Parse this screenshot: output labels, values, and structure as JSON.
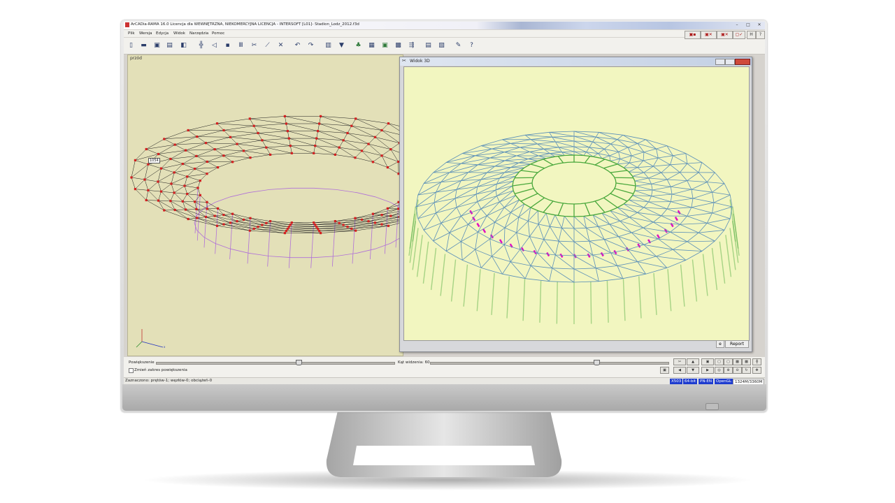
{
  "app": {
    "title": "ArCADia-RAMA 16.0 Licencja dla WEWNĘTRZNA, NIEKOMERCYJNA LICENCJA - INTERSOFT [L01]- Stadion_Lodz_2012.f3d",
    "window_controls": [
      "–",
      "□",
      "✕"
    ],
    "right_buttons": [
      "▣▪",
      "▣✕",
      "▣✕",
      "▢✓",
      "H",
      "?"
    ]
  },
  "menu": [
    "Plik",
    "Wersja",
    "Edycja",
    "Widok",
    "Narzędzia",
    "Pomoc"
  ],
  "toolbar": {
    "icons": [
      "new-file-icon",
      "open-folder-icon",
      "save-icon",
      "table-icon",
      "layers-icon",
      "grid-icon",
      "node-icon",
      "join-icon",
      "columns-icon",
      "cut-icon",
      "node-cut-icon",
      "delete-icon",
      "undo-icon",
      "redo-icon",
      "list-icon",
      "filter-icon",
      "tree-icon",
      "table-view-icon",
      "image-view-icon",
      "grid-view-icon",
      "align-icon",
      "calculator-icon",
      "report-icon",
      "wrench-icon",
      "help-icon"
    ]
  },
  "left_view": {
    "label": "przód",
    "node_tag": "1054",
    "axes": [
      "y",
      "z",
      "x"
    ]
  },
  "window_3d": {
    "title": "Widok 3D",
    "btn_e": "e",
    "report": "Report"
  },
  "bottom": {
    "zoom_label": "Powiększenie",
    "zoom_value": 0.6,
    "change_zoom_range": "Zmień zakres powiększenia",
    "angle_label": "Kąt widzenia: 60",
    "angle_value": 0.7
  },
  "status": {
    "text": "Zaznaczono: prętów-1; węzłów-0; obciążeń-0",
    "badges": [
      "X503",
      "64-bit",
      "PN-EN",
      "OpenGL"
    ],
    "memory": "1324M/3360M"
  },
  "colors": {
    "left_bg": "#e3e0b8",
    "model_red": "#d22020",
    "model_purple": "#b070d8",
    "view3d_bg": "#f2f6c0",
    "beam_blue": "#5a8fb8",
    "beam_green": "#4aa83c",
    "beam_magenta": "#e010c0"
  }
}
